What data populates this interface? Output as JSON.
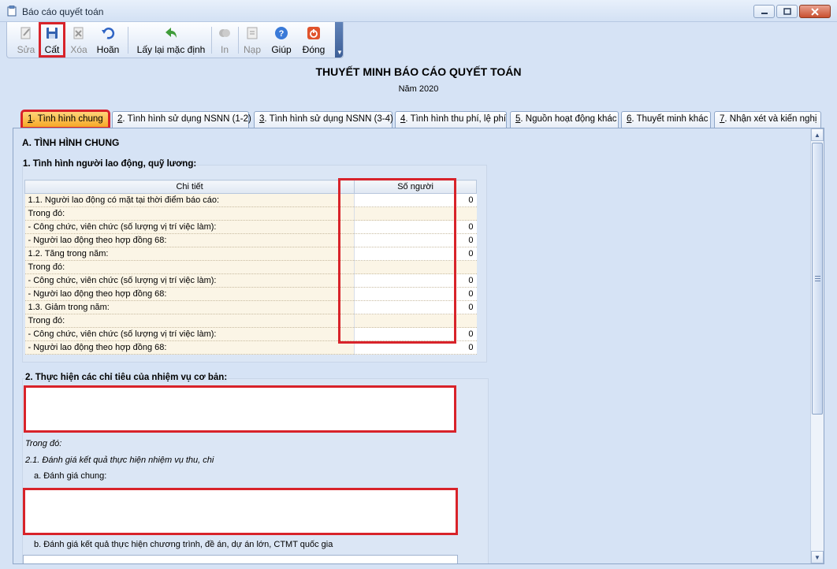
{
  "window": {
    "title": "Báo cáo quyết toán"
  },
  "toolbar": {
    "items": [
      {
        "label": "Sửa",
        "icon": "edit-icon",
        "enabled": false
      },
      {
        "label": "Cất",
        "icon": "save-icon",
        "enabled": true
      },
      {
        "label": "Xóa",
        "icon": "delete-icon",
        "enabled": false
      },
      {
        "label": "Hoãn",
        "icon": "undo-icon",
        "enabled": true
      },
      {
        "label": "Lấy lại mặc định",
        "icon": "reset-default-icon",
        "enabled": true
      },
      {
        "label": "In",
        "icon": "print-icon",
        "enabled": false
      },
      {
        "label": "Nạp",
        "icon": "load-icon",
        "enabled": false
      },
      {
        "label": "Giúp",
        "icon": "help-icon",
        "enabled": true
      },
      {
        "label": "Đóng",
        "icon": "close-form-icon",
        "enabled": true
      }
    ]
  },
  "header": {
    "title": "THUYẾT MINH BÁO CÁO QUYẾT TOÁN",
    "year": "Năm 2020"
  },
  "tabs": [
    {
      "num": "1",
      "rest": ". Tình hình chung",
      "active": true
    },
    {
      "num": "2",
      "rest": ". Tình hình sử dụng NSNN (1-2)",
      "active": false
    },
    {
      "num": "3",
      "rest": ". Tình hình sử dụng NSNN (3-4)",
      "active": false
    },
    {
      "num": "4",
      "rest": ". Tình hình thu phí, lệ phí",
      "active": false
    },
    {
      "num": "5",
      "rest": ". Nguồn hoạt động khác",
      "active": false
    },
    {
      "num": "6",
      "rest": ". Thuyết minh khác",
      "active": false
    },
    {
      "num": "7",
      "rest": ". Nhận xét và kiến nghị",
      "active": false
    }
  ],
  "section_a": {
    "title": "A. TÌNH HÌNH CHUNG",
    "sub1_title": "1. Tình hình người lao động, quỹ lương:",
    "table": {
      "col_detail": "Chi tiết",
      "col_count": "Số người",
      "rows": [
        {
          "label": "1.1. Người lao động có mặt tại thời điểm báo cáo:",
          "value": "0"
        },
        {
          "label": "Trong đó:",
          "value": ""
        },
        {
          "label": "- Công chức, viên chức (số lượng vị trí việc làm):",
          "value": "0"
        },
        {
          "label": "- Người lao động theo hợp đồng 68:",
          "value": "0"
        },
        {
          "label": "1.2. Tăng trong năm:",
          "value": "0"
        },
        {
          "label": "Trong đó:",
          "value": ""
        },
        {
          "label": "- Công chức, viên chức (số lượng vị trí việc làm):",
          "value": "0"
        },
        {
          "label": "- Người lao động theo hợp đồng 68:",
          "value": "0"
        },
        {
          "label": "1.3. Giảm trong năm:",
          "value": "0"
        },
        {
          "label": "Trong đó:",
          "value": ""
        },
        {
          "label": "- Công chức, viên chức (số lượng vị trí việc làm):",
          "value": "0"
        },
        {
          "label": "- Người lao động theo hợp đồng 68:",
          "value": "0"
        }
      ]
    },
    "sub2_title": "2. Thực hiện các chỉ tiêu của nhiệm vụ cơ bản:",
    "trong_do": "Trong đó:",
    "sub21": "2.1. Đánh giá kết quả thực hiện nhiệm vụ thu, chi",
    "sub21a": "a. Đánh giá chung:",
    "sub21b": "b. Đánh giá kết quả thực hiện chương trình, đề án, dự án lớn, CTMT quốc gia"
  },
  "colors": {
    "highlight": "#d8232a",
    "active_tab": "#f5a623",
    "background": "#d6e3f5"
  }
}
